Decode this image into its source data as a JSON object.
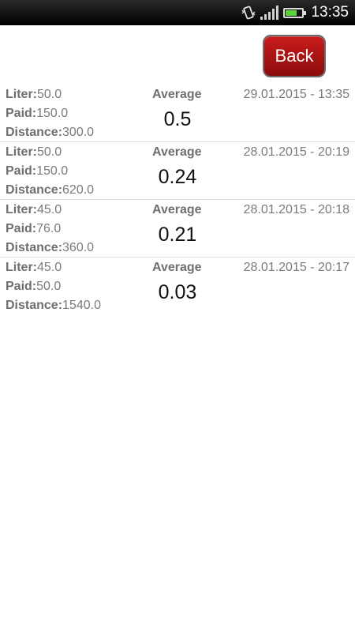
{
  "status_bar": {
    "time": "13:35",
    "battery_level": 0.7,
    "icons": [
      "vibrate-icon",
      "signal-icon",
      "battery-icon"
    ]
  },
  "back_button": {
    "label": "Back"
  },
  "labels": {
    "liter": "Liter:",
    "paid": "Paid:",
    "distance": "Distance:",
    "average": "Average"
  },
  "entries": [
    {
      "liter": "50.0",
      "paid": "150.0",
      "distance": "300.0",
      "average": "0.5",
      "date": "29.01.2015 - 13:35"
    },
    {
      "liter": "50.0",
      "paid": "150.0",
      "distance": "620.0",
      "average": "0.24",
      "date": "28.01.2015 - 20:19"
    },
    {
      "liter": "45.0",
      "paid": "76.0",
      "distance": "360.0",
      "average": "0.21",
      "date": "28.01.2015 - 20:18"
    },
    {
      "liter": "45.0",
      "paid": "50.0",
      "distance": "1540.0",
      "average": "0.03",
      "date": "28.01.2015 - 20:17"
    }
  ],
  "colors": {
    "button": "#b01414",
    "battery": "#5bd33b",
    "status_bar": "#000000"
  }
}
